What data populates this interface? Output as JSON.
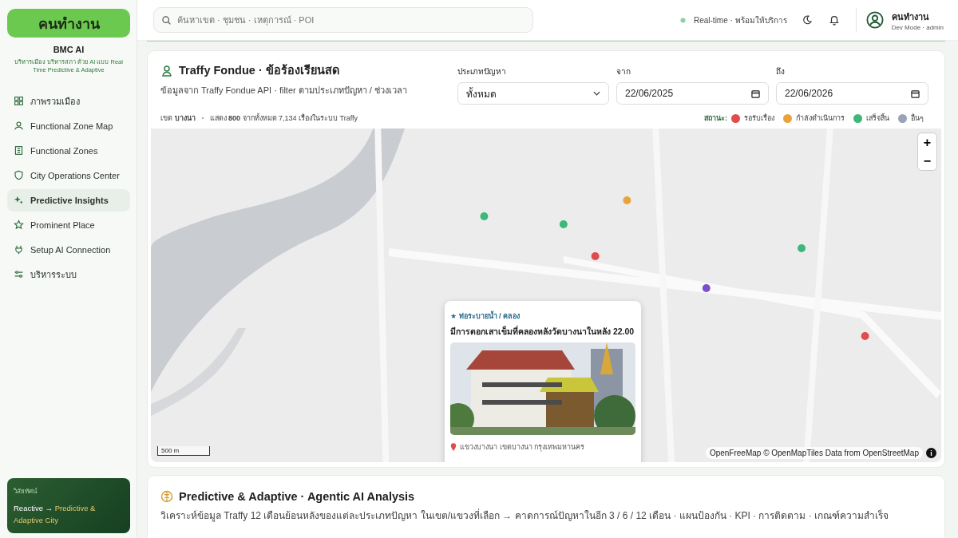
{
  "sidebar": {
    "logo": "คนทำงาน",
    "brand": "BMC AI",
    "tagline": "บริหารเมือง บริหารสภา ด้วย AI แบบ Real Time Predictive & Adaptive",
    "items": [
      {
        "label": "ภาพรวมเมือง",
        "selected": false
      },
      {
        "label": "Functional Zone Map",
        "selected": false
      },
      {
        "label": "Functional Zones",
        "selected": false
      },
      {
        "label": "City Operations Center",
        "selected": false
      },
      {
        "label": "Predictive Insights",
        "selected": true
      },
      {
        "label": "Prominent Place",
        "selected": false
      },
      {
        "label": "Setup AI Connection",
        "selected": false
      },
      {
        "label": "บริหารระบบ",
        "selected": false
      }
    ],
    "vision": {
      "heading": "วิสัยทัศน์",
      "from": "Reactive",
      "arrow": "→",
      "to": "Predictive & Adaptive City"
    }
  },
  "header": {
    "search": {
      "placeholder": "ค้นหาเขต · ชุมชน · เหตุการณ์ · POI"
    },
    "status": "Real-time · พร้อมให้บริการ",
    "user": {
      "name": "คนทำงาน",
      "role": "Dev Mode · admin"
    }
  },
  "traffy": {
    "title": "Traffy Fondue · ข้อร้องเรียนสด",
    "subtitle": "ข้อมูลจาก Traffy Fondue API · filter ตามประเภทปัญหา / ช่วงเวลา",
    "filters": {
      "type": {
        "label": "ประเภทปัญหา",
        "value": "ทั้งหมด"
      },
      "from": {
        "label": "จาก",
        "value": "22/06/2025"
      },
      "to": {
        "label": "ถึง",
        "value": "22/06/2026"
      }
    },
    "district_label": "เขต",
    "district": "บางนา",
    "showing": "แสดง **800** จากทั้งหมด 7,134 เรื่องในระบบ Traffy",
    "legend_label": "สถานะ:",
    "legend": [
      {
        "label": "รอรับเรื่อง",
        "color": "#e04b4b"
      },
      {
        "label": "กำลังดำเนินการ",
        "color": "#e8a33c"
      },
      {
        "label": "เสร็จสิ้น",
        "color": "#3cb878"
      },
      {
        "label": "อื่นๆ",
        "color": "#9aa3b5"
      }
    ],
    "map": {
      "zoom_in": "+",
      "zoom_out": "−",
      "scale": "500 m",
      "attribution": "OpenFreeMap © OpenMapTiles Data from OpenStreetMap",
      "info": "i",
      "popup": {
        "category": "★ ท่อระบายน้ำ / คลอง",
        "title": "มีการตอกเสาเข็มที่คลองหลังวัดบางนาในหลัง 22.00",
        "location": "แขวงบางนา เขตบางนา กรุงเทพมหานคร"
      }
    }
  },
  "analysis": {
    "title": "Predictive & Adaptive · Agentic AI Analysis",
    "description": "วิเคราะห์ข้อมูล Traffy 12 เดือนย้อนหลังของแต่ละประเภทปัญหา ในเขต/แขวงที่เลือก → คาดการณ์ปัญหาในอีก 3 / 6 / 12 เดือน · แผนป้องกัน · KPI · การติดตาม · เกณฑ์ความสำเร็จ"
  }
}
